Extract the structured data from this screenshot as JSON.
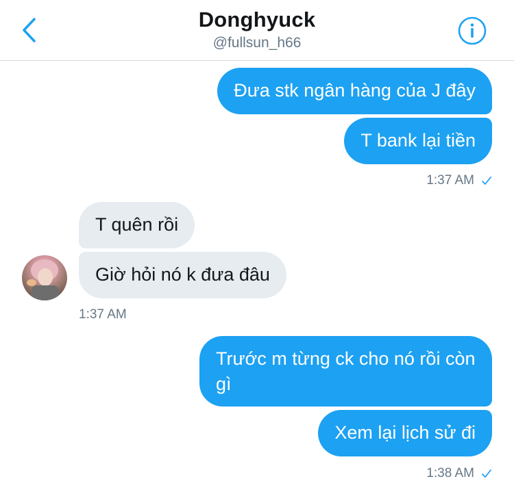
{
  "header": {
    "title": "Donghyuck",
    "handle": "@fullsun_h66"
  },
  "colors": {
    "accent": "#1da1f2",
    "received_bubble": "#e6ecf0",
    "meta_text": "#657786"
  },
  "icons": {
    "back": "chevron-left-icon",
    "info": "info-circle-icon",
    "read_receipt": "checkmark-icon"
  },
  "messages": [
    {
      "direction": "sent",
      "text": "Đưa stk ngân hàng của J đây"
    },
    {
      "direction": "sent",
      "text": "T bank lại tiền"
    },
    {
      "direction": "received",
      "text": "T quên rồi"
    },
    {
      "direction": "received",
      "text": "Giờ hỏi nó k đưa đâu"
    },
    {
      "direction": "sent",
      "text": "Trước m từng ck cho nó rồi còn gì"
    },
    {
      "direction": "sent",
      "text": "Xem lại lịch sử đi"
    }
  ],
  "timestamps": {
    "group1": "1:37 AM",
    "group2": "1:37 AM",
    "group3": "1:38 AM"
  }
}
